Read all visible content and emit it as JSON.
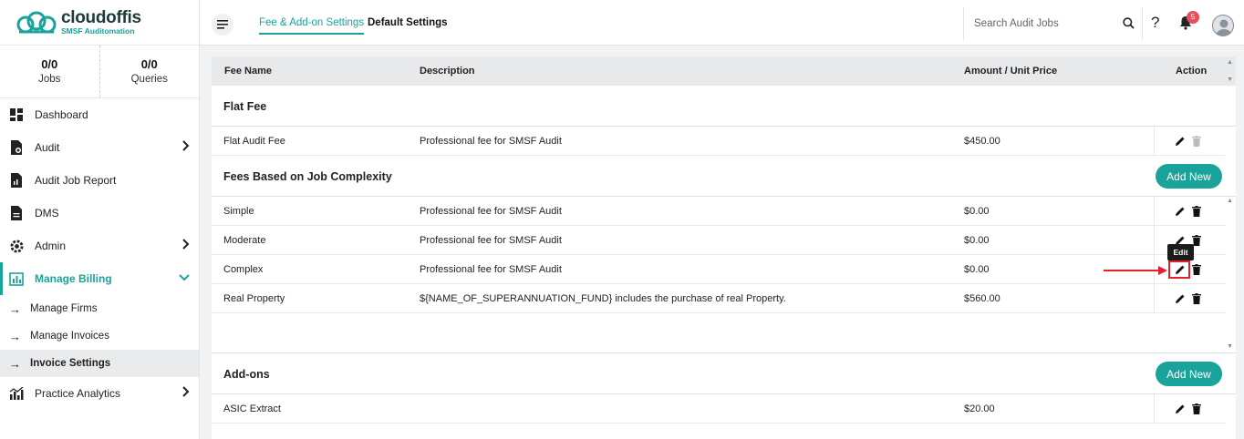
{
  "brand": {
    "name": "cloudoffis",
    "tagline": "SMSF Auditomation"
  },
  "stats": [
    {
      "value": "0/0",
      "label": "Jobs"
    },
    {
      "value": "0/0",
      "label": "Queries"
    }
  ],
  "nav": {
    "dashboard": "Dashboard",
    "audit": "Audit",
    "audit_job_report": "Audit Job Report",
    "dms": "DMS",
    "admin": "Admin",
    "manage_billing": "Manage Billing",
    "manage_firms": "Manage Firms",
    "manage_invoices": "Manage Invoices",
    "invoice_settings": "Invoice Settings",
    "practice_analytics": "Practice Analytics"
  },
  "header": {
    "tabs": [
      "Fee & Add-on Settings",
      "Default Settings"
    ],
    "search_placeholder": "Search Audit Jobs",
    "help_glyph": "?",
    "notification_count": "5"
  },
  "table": {
    "columns": [
      "Fee Name",
      "Description",
      "Amount / Unit Price",
      "Action"
    ],
    "sections": [
      {
        "title": "Flat Fee",
        "rows": [
          {
            "name": "Flat Audit Fee",
            "description": "Professional fee for SMSF Audit",
            "amount": "$450.00"
          }
        ]
      },
      {
        "title": "Fees Based on Job Complexity",
        "add_label": "Add New",
        "rows": [
          {
            "name": "Simple",
            "description": "Professional fee for SMSF Audit",
            "amount": "$0.00"
          },
          {
            "name": "Moderate",
            "description": "Professional fee for SMSF Audit",
            "amount": "$0.00"
          },
          {
            "name": "Complex",
            "description": "Professional fee for SMSF Audit",
            "amount": "$0.00"
          },
          {
            "name": "Real Property",
            "description": "${NAME_OF_SUPERANNUATION_FUND} includes the purchase of real Property.",
            "amount": "$560.00"
          }
        ]
      },
      {
        "title": "Add-ons",
        "add_label": "Add New",
        "rows": [
          {
            "name": "ASIC Extract",
            "description": "",
            "amount": "$20.00"
          }
        ]
      }
    ]
  },
  "tooltip": "Edit",
  "colors": {
    "accent": "#1aa39a",
    "annotation": "#e4202a",
    "badge": "#e84c5d"
  }
}
